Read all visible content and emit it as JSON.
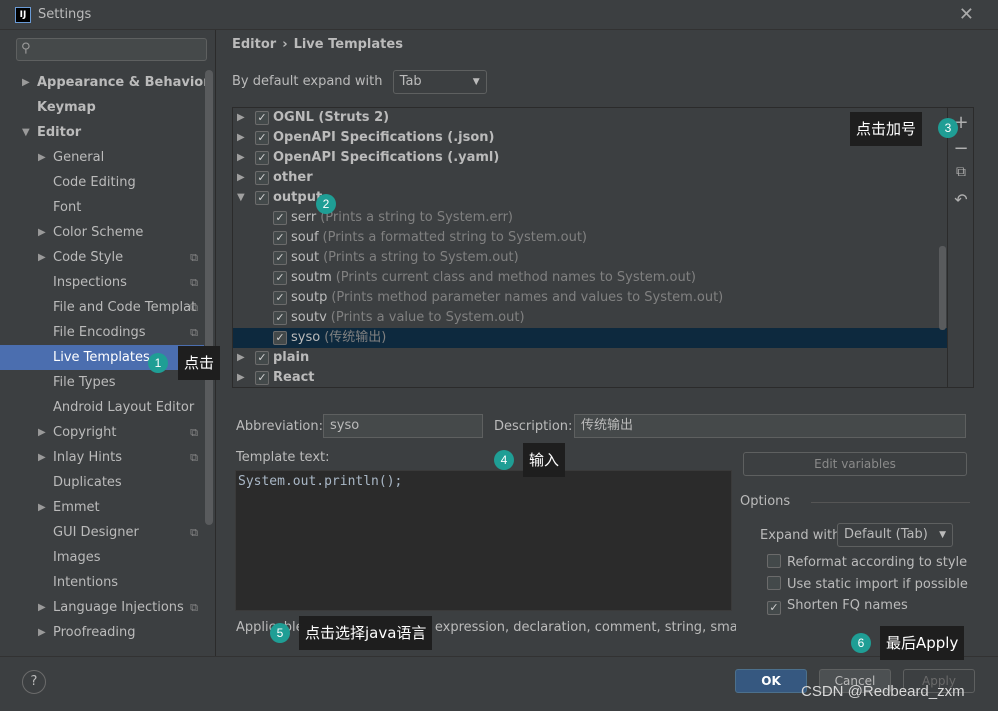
{
  "window": {
    "title": "Settings",
    "app_icon_text": "IJ"
  },
  "sidebar": {
    "search_placeholder": "",
    "items": [
      {
        "label": "Appearance & Behavior",
        "level": 0,
        "arrow": "right",
        "bold": true
      },
      {
        "label": "Keymap",
        "level": 0,
        "arrow": "",
        "bold": true
      },
      {
        "label": "Editor",
        "level": 0,
        "arrow": "down",
        "bold": true
      },
      {
        "label": "General",
        "level": 1,
        "arrow": "right"
      },
      {
        "label": "Code Editing",
        "level": 1,
        "arrow": ""
      },
      {
        "label": "Font",
        "level": 1,
        "arrow": ""
      },
      {
        "label": "Color Scheme",
        "level": 1,
        "arrow": "right"
      },
      {
        "label": "Code Style",
        "level": 1,
        "arrow": "right",
        "copy": true
      },
      {
        "label": "Inspections",
        "level": 1,
        "arrow": "",
        "copy": true
      },
      {
        "label": "File and Code Templat",
        "level": 1,
        "arrow": "",
        "copy": true
      },
      {
        "label": "File Encodings",
        "level": 1,
        "arrow": "",
        "copy": true
      },
      {
        "label": "Live Templates",
        "level": 1,
        "arrow": "",
        "selected": true
      },
      {
        "label": "File Types",
        "level": 1,
        "arrow": ""
      },
      {
        "label": "Android Layout Editor",
        "level": 1,
        "arrow": ""
      },
      {
        "label": "Copyright",
        "level": 1,
        "arrow": "right",
        "copy": true
      },
      {
        "label": "Inlay Hints",
        "level": 1,
        "arrow": "right",
        "copy": true
      },
      {
        "label": "Duplicates",
        "level": 1,
        "arrow": ""
      },
      {
        "label": "Emmet",
        "level": 1,
        "arrow": "right"
      },
      {
        "label": "GUI Designer",
        "level": 1,
        "arrow": "",
        "copy": true
      },
      {
        "label": "Images",
        "level": 1,
        "arrow": ""
      },
      {
        "label": "Intentions",
        "level": 1,
        "arrow": ""
      },
      {
        "label": "Language Injections",
        "level": 1,
        "arrow": "right",
        "copy": true
      },
      {
        "label": "Proofreading",
        "level": 1,
        "arrow": "right"
      }
    ]
  },
  "breadcrumb": {
    "parent": "Editor",
    "separator": "›",
    "current": "Live Templates"
  },
  "expand": {
    "label": "By default expand with",
    "value": "Tab"
  },
  "templates": [
    {
      "type": "group",
      "name": "OGNL (Struts 2)",
      "expanded": false,
      "checked": true
    },
    {
      "type": "group",
      "name": "OpenAPI Specifications (.json)",
      "expanded": false,
      "checked": true
    },
    {
      "type": "group",
      "name": "OpenAPI Specifications (.yaml)",
      "expanded": false,
      "checked": true
    },
    {
      "type": "group",
      "name": "other",
      "expanded": false,
      "checked": true
    },
    {
      "type": "group",
      "name": "output",
      "expanded": true,
      "checked": true
    },
    {
      "type": "item",
      "name": "serr",
      "desc": "(Prints a string to System.err)",
      "checked": true
    },
    {
      "type": "item",
      "name": "souf",
      "desc": "(Prints a formatted string to System.out)",
      "checked": true
    },
    {
      "type": "item",
      "name": "sout",
      "desc": "(Prints a string to System.out)",
      "checked": true
    },
    {
      "type": "item",
      "name": "soutm",
      "desc": "(Prints current class and method names to System.out)",
      "checked": true
    },
    {
      "type": "item",
      "name": "soutp",
      "desc": "(Prints method parameter names and values to System.out)",
      "checked": true
    },
    {
      "type": "item",
      "name": "soutv",
      "desc": "(Prints a value to System.out)",
      "checked": true
    },
    {
      "type": "item",
      "name": "syso",
      "desc": "(传统输出)",
      "checked": true,
      "selected": true
    },
    {
      "type": "group",
      "name": "plain",
      "expanded": false,
      "checked": true
    },
    {
      "type": "group",
      "name": "React",
      "expanded": false,
      "checked": true
    }
  ],
  "tools": {
    "add": "+",
    "remove": "−",
    "copy": "⧉",
    "restore": "↶"
  },
  "editor": {
    "abbreviation_label": "Abbreviation:",
    "abbreviation_value": "syso",
    "description_label": "Description:",
    "description_value": "传统输出",
    "template_text_label": "Template text:",
    "template_text": "System.out.println();",
    "edit_variables": "Edit variables",
    "applicable": "Applicable in Java: statement, expression, declaration, comment, string, smart ty"
  },
  "options": {
    "title": "Options",
    "expand_with_label": "Expand with",
    "expand_with_value": "Default (Tab)",
    "reformat": {
      "label": "Reformat according to style",
      "checked": false
    },
    "static_import": {
      "label": "Use static import if possible",
      "checked": false
    },
    "shorten_fq": {
      "label": "Shorten FQ names",
      "checked": true
    }
  },
  "footer": {
    "help": "?",
    "ok": "OK",
    "cancel": "Cancel",
    "apply": "Apply"
  },
  "annotations": [
    {
      "num": "1",
      "text": "点击"
    },
    {
      "num": "2",
      "text": ""
    },
    {
      "num": "3",
      "text": "点击加号"
    },
    {
      "num": "4",
      "text": "输入"
    },
    {
      "num": "5",
      "text": "点击选择java语言"
    },
    {
      "num": "6",
      "text": "最后Apply"
    }
  ],
  "watermark": "CSDN @Redbeard_zxm",
  "colors": {
    "selection": "#4b6eaf",
    "row_selection": "#0d293e",
    "ok_button": "#365880",
    "badge": "#1f9e95"
  }
}
